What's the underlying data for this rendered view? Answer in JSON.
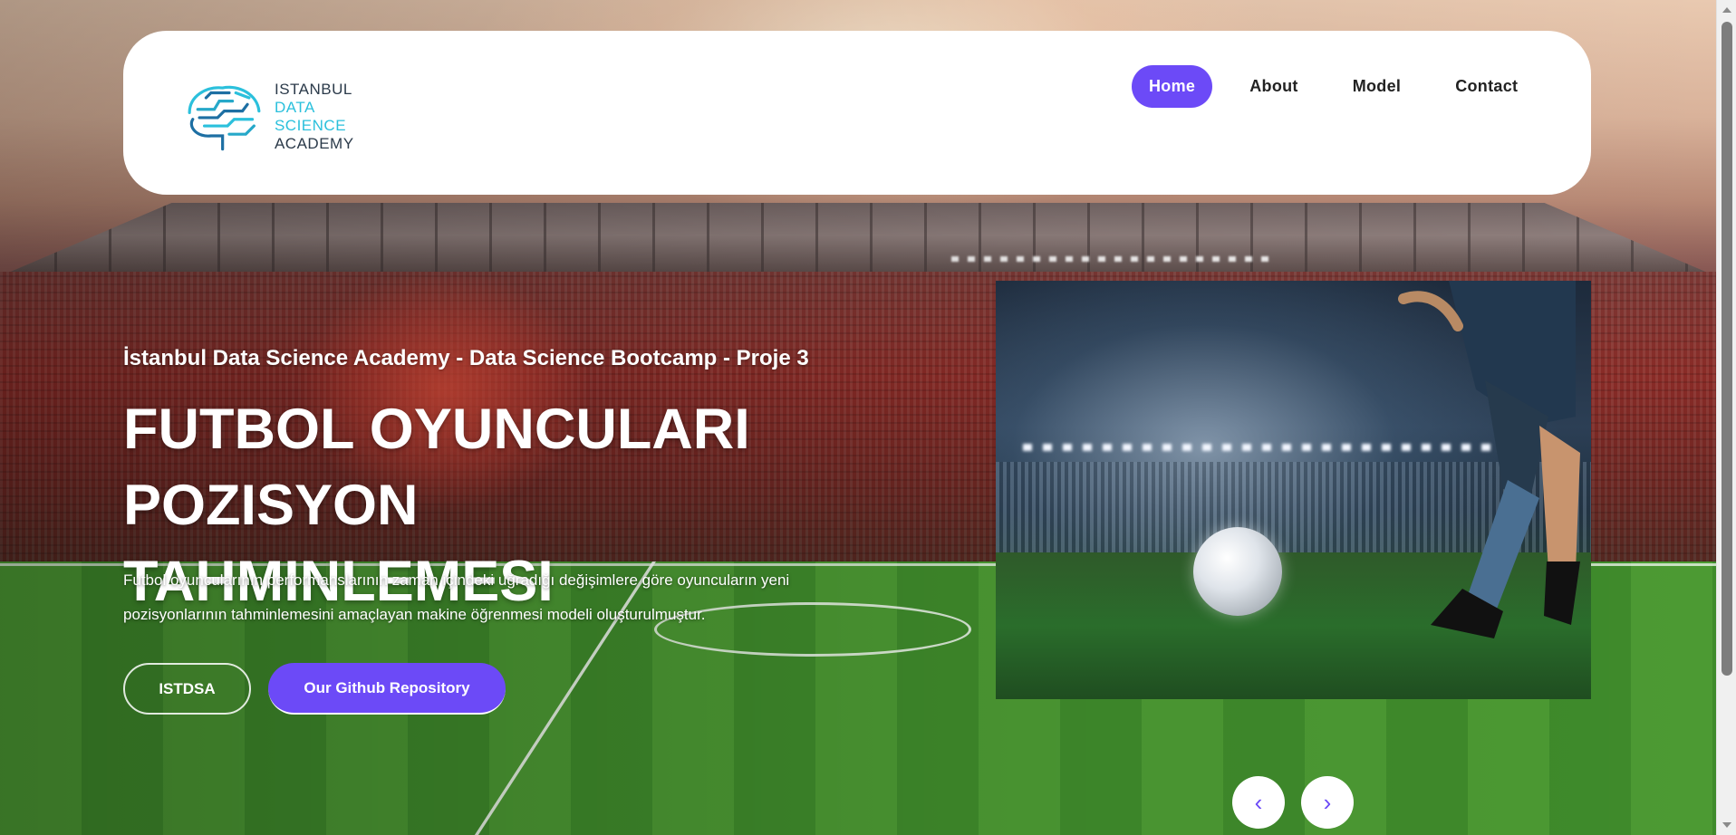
{
  "header": {
    "logo": {
      "line1": "ISTANBUL",
      "line2": "DATA SCIENCE",
      "line3": "ACADEMY"
    },
    "nav": [
      {
        "label": "Home",
        "active": true
      },
      {
        "label": "About",
        "active": false
      },
      {
        "label": "Model",
        "active": false
      },
      {
        "label": "Contact",
        "active": false
      }
    ]
  },
  "hero": {
    "subtitle": "İstanbul Data Science Academy - Data Science Bootcamp - Proje 3",
    "title_line1": "FUTBOL OYUNCULARI",
    "title_line2": "POZISYON TAHMINLEMESI",
    "description": "Futbol oyuncularının performanslarının zaman içindeki uğradığı değişimlere göre oyuncuların yeni pozisyonlarının tahminlemesini amaçlayan makine öğrenmesi modeli oluşturulmuştur.",
    "buttons": {
      "secondary": "ISTDSA",
      "primary": "Our Github Repository"
    }
  },
  "carousel": {
    "prev_symbol": "‹",
    "next_symbol": "›"
  },
  "colors": {
    "accent": "#6c4af7",
    "header_bg": "#ffffff"
  },
  "icons": [
    "brain-circuit-logo-icon",
    "chevron-left-icon",
    "chevron-right-icon",
    "scroll-up-arrow-icon",
    "scroll-down-arrow-icon"
  ]
}
